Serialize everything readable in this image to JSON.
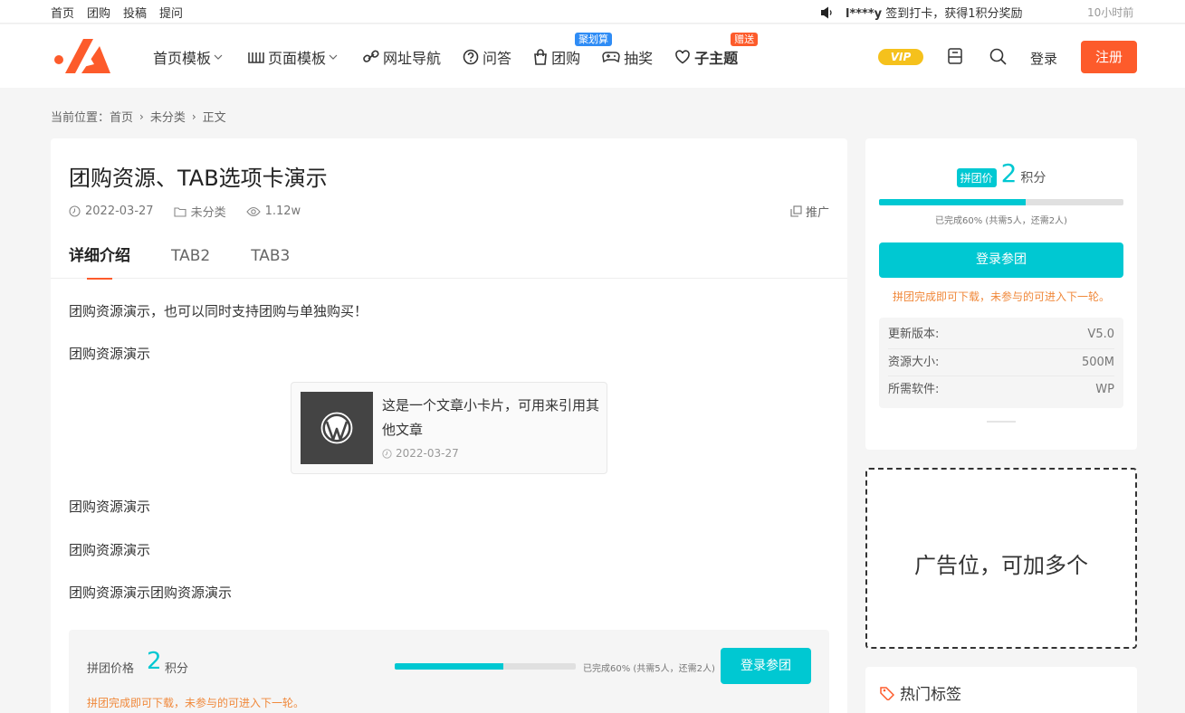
{
  "topbar": {
    "links": [
      "首页",
      "团购",
      "投稿",
      "提问"
    ],
    "notice_user": "l****y",
    "notice_text": " 签到打卡，获得1积分奖励",
    "time": "10小时前"
  },
  "nav": {
    "items": [
      {
        "label": "首页模板",
        "icon": "none",
        "chevron": true
      },
      {
        "label": "页面模板",
        "icon": "book-icon",
        "chevron": true
      },
      {
        "label": "网址导航",
        "icon": "link-icon"
      },
      {
        "label": "问答",
        "icon": "question-icon"
      },
      {
        "label": "团购",
        "icon": "bag-icon",
        "badge": "聚划算",
        "badge_color": "#2f8cf5"
      },
      {
        "label": "抽奖",
        "icon": "gamepad-icon"
      },
      {
        "label": "子主题",
        "icon": "heart-icon",
        "badge": "赠送",
        "badge_color": "#fd5b2b"
      }
    ],
    "vip": "VIP",
    "login": "登录",
    "register": "注册",
    "accent": "#fd5b2b"
  },
  "breadcrumb": {
    "prefix": "当前位置：",
    "items": [
      "首页",
      "未分类",
      "正文"
    ]
  },
  "article": {
    "title": "团购资源、TAB选项卡演示",
    "date": "2022-03-27",
    "category": "未分类",
    "views": "1.12w",
    "promote": "推广",
    "tabs": [
      "详细介绍",
      "TAB2",
      "TAB3"
    ],
    "paragraphs": [
      "团购资源演示，也可以同时支持团购与单独购买！",
      "团购资源演示",
      "团购资源演示",
      "团购资源演示",
      "团购资源演示团购资源演示"
    ],
    "card": {
      "title": "这是一个文章小卡片，可用来引用其他文章",
      "date": "2022-03-27"
    }
  },
  "group": {
    "label": "拼团价格",
    "price": "2",
    "unit": "积分",
    "progress_fraction": 0.6,
    "progress_text": "已完成60% (共需5人，还需2人)",
    "button": "登录参团",
    "hint": "拼团完成即可下载，未参与的可进入下一轮。"
  },
  "sidebar": {
    "price_tag": "拼团价",
    "price": "2",
    "unit": "积分",
    "progress_fraction": 0.6,
    "progress_text": "已完成60% (共需5人，还需2人)",
    "button": "登录参团",
    "hint": "拼团完成即可下载，未参与的可进入下一轮。",
    "info": [
      {
        "key": "更新版本:",
        "value": "V5.0"
      },
      {
        "key": "资源大小:",
        "value": "500M"
      },
      {
        "key": "所需软件:",
        "value": "WP"
      }
    ],
    "ad_text": "广告位，可加多个",
    "hot_tags": "热门标签",
    "accent": "#00c8d2"
  }
}
